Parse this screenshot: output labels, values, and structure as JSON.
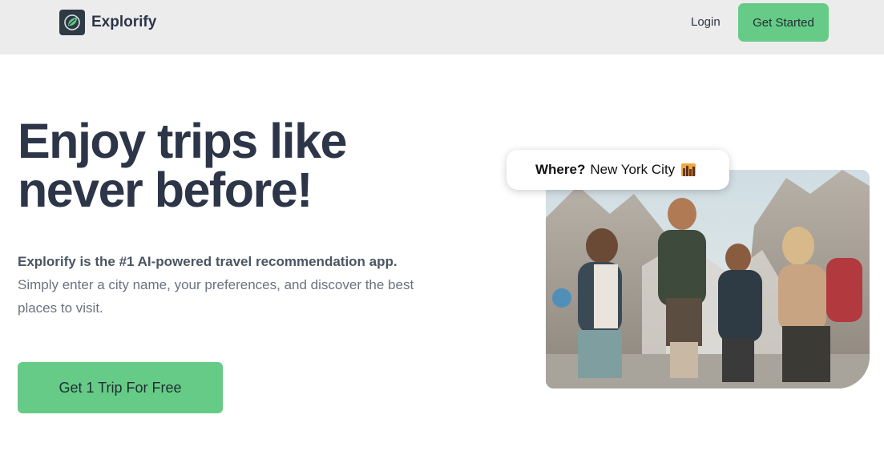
{
  "nav": {
    "brand": "Explorify",
    "logo_icon": "leaf-globe-icon",
    "login_label": "Login",
    "cta_label": "Get Started"
  },
  "hero": {
    "headline_highlight": "Enjoy",
    "headline_rest_line1": " trips like",
    "headline_line2": "never before!",
    "description_bold": "Explorify is the #1 AI-powered travel recommendation app.",
    "description_rest": "Simply enter a city name, your preferences, and discover the best places to visit.",
    "cta_label": "Get 1 Trip For Free"
  },
  "search_pill": {
    "label": "Where?",
    "value": "New York City",
    "icon": "cityscape-emoji-icon"
  },
  "image": {
    "name": "group-of-hikers-photo"
  },
  "colors": {
    "accent": "#66cb86",
    "nav_bg": "#ececec",
    "heading": "#2d3648"
  }
}
